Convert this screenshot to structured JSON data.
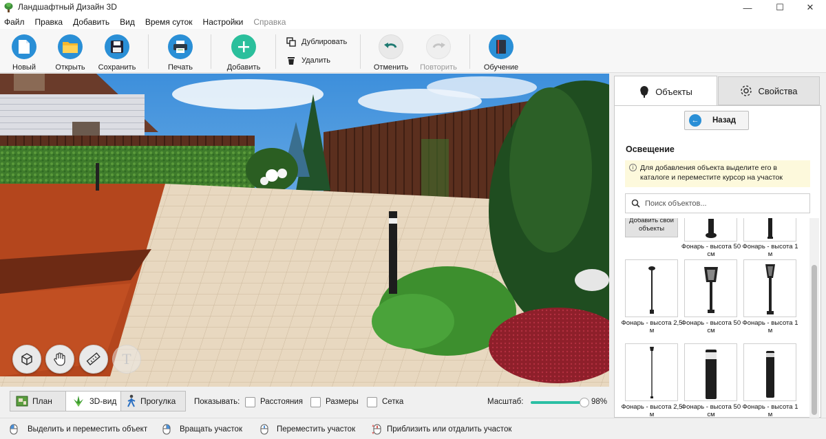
{
  "window": {
    "title": "Ландшафтный Дизайн 3D",
    "minimize": "—",
    "maximize": "☐",
    "close": "✕"
  },
  "menu": [
    {
      "label": "Файл",
      "enabled": true
    },
    {
      "label": "Правка",
      "enabled": true
    },
    {
      "label": "Добавить",
      "enabled": true
    },
    {
      "label": "Вид",
      "enabled": true
    },
    {
      "label": "Время суток",
      "enabled": true
    },
    {
      "label": "Настройки",
      "enabled": true
    },
    {
      "label": "Справка",
      "enabled": false
    }
  ],
  "toolbar": {
    "new": "Новый",
    "open": "Открыть",
    "save": "Сохранить",
    "print": "Печать",
    "add": "Добавить",
    "duplicate": "Дублировать",
    "delete": "Удалить",
    "undo": "Отменить",
    "redo": "Повторить",
    "learn": "Обучение"
  },
  "view_tabs": {
    "plan": "План",
    "view3d": "3D-вид",
    "walk": "Прогулка",
    "active": "3D-вид"
  },
  "show": {
    "label": "Показывать:",
    "options": [
      {
        "label": "Расстояния",
        "checked": false
      },
      {
        "label": "Размеры",
        "checked": false
      },
      {
        "label": "Сетка",
        "checked": false
      }
    ]
  },
  "zoom": {
    "label": "Масштаб:",
    "value_text": "98%",
    "fraction": 0.98
  },
  "status": {
    "select": "Выделить и переместить объект",
    "rotate": "Вращать участок",
    "move": "Переместить участок",
    "zoom": "Приблизить или отдалить участок"
  },
  "panel": {
    "tab_objects": "Объекты",
    "tab_props": "Свойства",
    "back": "Назад",
    "section": "Освещение",
    "hint": "Для добавления объекта выделите его в каталоге и переместите курсор на участок",
    "search_placeholder": "Поиск объектов...",
    "add_own": "Добавить свои объекты",
    "top_row": [
      {
        "label": "Фонарь - высота 50 см"
      },
      {
        "label": "Фонарь - высота 1 м"
      }
    ],
    "items": [
      {
        "label": "Фонарь - высота 2,5 м",
        "icon": "tall-lamp-icon"
      },
      {
        "label": "Фонарь - высота 50 см",
        "icon": "lantern-icon"
      },
      {
        "label": "Фонарь - высота 1 м",
        "icon": "lantern-post-icon"
      },
      {
        "label": "Фонарь - высота 2,5 м",
        "icon": "thin-lamp-icon"
      },
      {
        "label": "Фонарь - высота 50 см",
        "icon": "bollard-icon"
      },
      {
        "label": "Фонарь - высота 1 м",
        "icon": "bollard-slim-icon"
      }
    ]
  },
  "colors": {
    "accent": "#2a8fd6",
    "add_green": "#2bbf9c",
    "scene_sky": "#4f9fe0",
    "fence": "#5a2e1d",
    "paving": "#e7d7bf"
  }
}
